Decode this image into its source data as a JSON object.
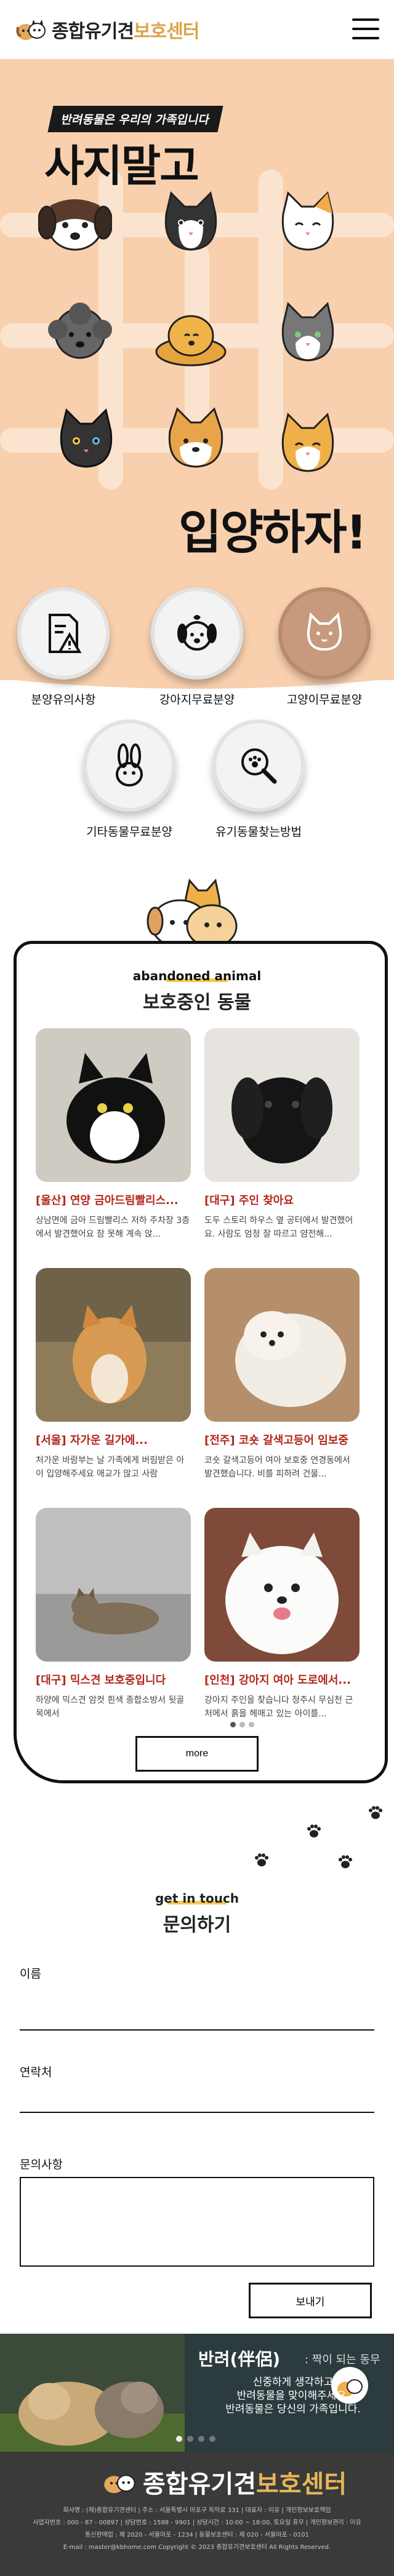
{
  "header": {
    "logo_main": "종합유기견",
    "logo_accent": "보호센터"
  },
  "hero": {
    "tag": "반려동물은 우리의 가족입니다",
    "title_top": "사지말고",
    "title_bottom": "입양하자!"
  },
  "categories": [
    {
      "label": "분양유의사항",
      "icon": "document-warning-icon"
    },
    {
      "label": "강아지무료분양",
      "icon": "dog-face-icon"
    },
    {
      "label": "고양이무료분양",
      "icon": "cat-face-icon"
    },
    {
      "label": "기타동물무료분양",
      "icon": "rabbit-icon"
    },
    {
      "label": "유기동물찾는방법",
      "icon": "search-paw-icon"
    }
  ],
  "shelter": {
    "en_title": "abandoned animal",
    "ko_title": "보호중인 동물",
    "more_label": "more",
    "cards": [
      {
        "title": "[울산] 연양 금아드림빨리스...",
        "desc": "상남면에 금아 드림빨리스 저하 주차장 3층에서 발견했어요 잠 못해 계속 앉..."
      },
      {
        "title": "[대구] 주인 찾아요",
        "desc": "도두 스토리 하우스 옆 공터에서 발견했어요. 사람도 엄청 잘 따르고 얌전해..."
      },
      {
        "title": "[서울] 자가운 길가에...",
        "desc": "처가운 바람부는 날 가족에게 버림받은 아이 입양해주세요 애교가 많고 사람"
      },
      {
        "title": "[전주] 코숏 갈색고등어 임보중",
        "desc": "코숏 갈색고등어 여아 보호중 연경동에서 발견했습니다. 비를 피하려 건물..."
      },
      {
        "title": "[대구] 믹스견 보호중입니다",
        "desc": "하양에 믹스견 암컷 흰색 종합소방서 뒷골목에서"
      },
      {
        "title": "[인천] 강아지 여아 도로에서...",
        "desc": "강아지 주인을 찾습니다 청주시 무심천 근처에서 흙을 헤매고 있는 아이를..."
      }
    ]
  },
  "contact": {
    "en_title": "get in touch",
    "ko_title": "문의하기",
    "name_label": "이름",
    "phone_label": "연락처",
    "message_label": "문의사항",
    "send_label": "보내기"
  },
  "banner": {
    "title": "반려(伴侶)",
    "subtitle": ": 짝이 되는 동무",
    "line1": "신중하게 생각하고",
    "line2": "반려동물을 맞이해주세요.",
    "line3": "반려동물은 당신의 가족입니다."
  },
  "footer": {
    "logo_main": "종합유기견",
    "logo_accent": "보호센터",
    "line1": "회사명 : (재)종합유기견센터 | 주소 : 서울특별시 마포구 독막로 331 | 대표자 : 이유 | 개인정보보호책임",
    "line2": "사업자번호 : 000 - 87 - 00897 | 상담번호 : 1588 - 9901 | 상담시간 : 10:00 ~ 18:00, 토요일 휴무 | 개인정보관리 : 이유",
    "line3": "통신판매업 : 제 2020 - 서울마포 - 1234 | 동물보호센터 : 제 020 - 서울마포 - 0101",
    "line4": "E-mail : master@kbhome.com Copyright © 2023 종합유기견보호센터 All Rights Reserved."
  },
  "colors": {
    "hero_bg": "#f8d0ae",
    "accent_gold": "#d9a449",
    "title_red": "#b3261e",
    "highlight_yellow": "#f6c94a",
    "footer_bg": "#3a3a3a"
  }
}
